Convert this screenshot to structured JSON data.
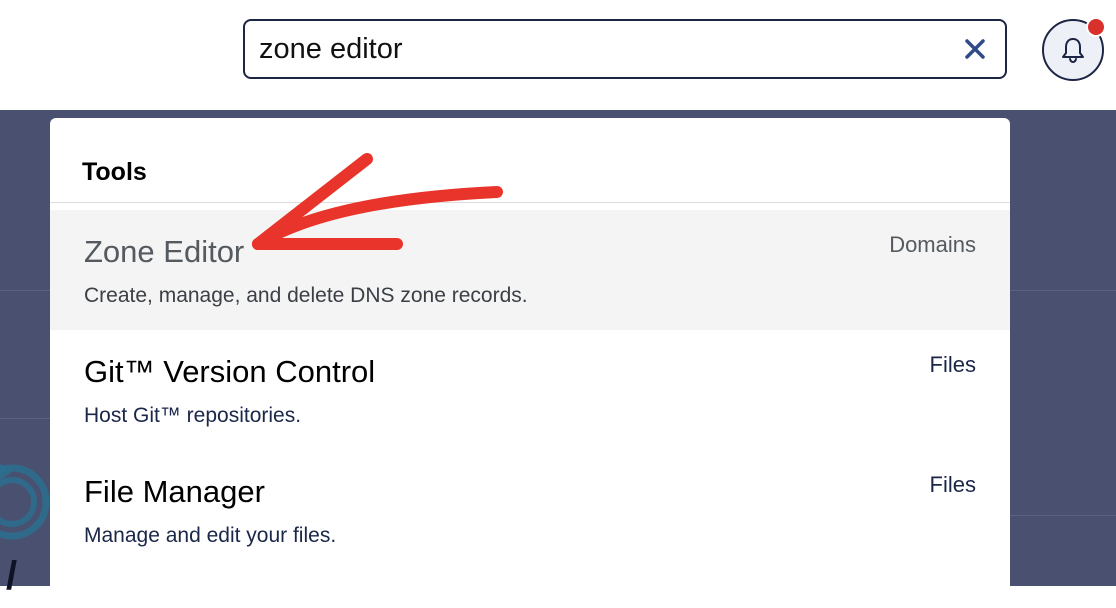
{
  "search": {
    "value": "zone editor",
    "clear_icon": "close-icon"
  },
  "notifications": {
    "icon": "bell-icon",
    "has_unread": true,
    "dot_color": "#d9302c"
  },
  "dropdown": {
    "section_title": "Tools",
    "results": [
      {
        "title": "Zone Editor",
        "description": "Create, manage, and delete DNS zone records.",
        "category": "Domains",
        "highlighted": true
      },
      {
        "title": "Git™ Version Control",
        "description": "Host Git™ repositories.",
        "category": "Files",
        "highlighted": false
      },
      {
        "title": "File Manager",
        "description": "Manage and edit your files.",
        "category": "Files",
        "highlighted": false
      }
    ]
  },
  "annotation": {
    "icon": "arrow-annotation-icon",
    "color": "#e8342a"
  },
  "colors": {
    "accent": "#1d2544",
    "backdrop": "#4a5170",
    "highlight_row": "#f3f4f3"
  }
}
